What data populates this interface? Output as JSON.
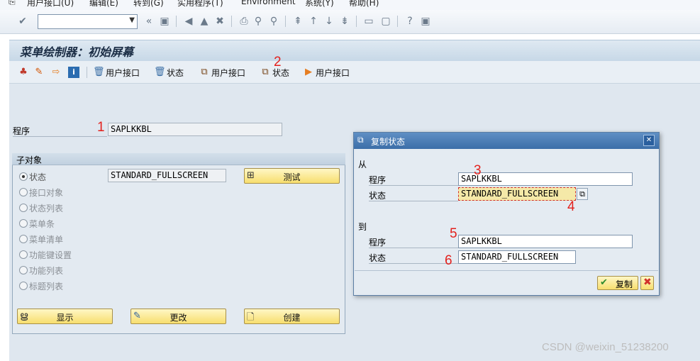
{
  "menu": {
    "items": [
      "用户接口(U)",
      "编辑(E)",
      "转到(G)",
      "实用程序(T)",
      "Environment",
      "系统(Y)",
      "帮助(H)"
    ]
  },
  "toolbar": {
    "command_value": "",
    "icons": [
      "enter-icon",
      "save-icon",
      "back-icon",
      "exit-icon",
      "cancel-icon",
      "print-icon",
      "find-icon",
      "find-next-icon",
      "first-page-icon",
      "prev-page-icon",
      "next-page-icon",
      "last-page-icon",
      "new-session-icon",
      "shortcut-icon",
      "help-icon",
      "layout-icon"
    ]
  },
  "page": {
    "title": "菜单绘制器：初始屏幕"
  },
  "app_toolbar": {
    "btn_user_interface_1": "用户接口",
    "btn_status_1": "状态",
    "btn_user_interface_2": "用户接口",
    "btn_status_2": "状态",
    "btn_user_interface_3": "用户接口"
  },
  "main": {
    "program_label": "程序",
    "program_value": "SAPLKKBL",
    "group_title": "子对象",
    "status_value": "STANDARD_FULLSCREEN",
    "radios": [
      "状态",
      "接口对象",
      "状态列表",
      "菜单条",
      "菜单清单",
      "功能键设置",
      "功能列表",
      "标题列表"
    ],
    "selected_radio": "状态",
    "test_button": "测试",
    "display_button": "显示",
    "change_button": "更改",
    "create_button": "创建"
  },
  "dialog": {
    "title": "复制状态",
    "from_label": "从",
    "from_program_label": "程序",
    "from_program_value": "SAPLKKBL",
    "from_status_label": "状态",
    "from_status_value": "STANDARD_FULLSCREEN",
    "to_label": "到",
    "to_program_label": "程序",
    "to_program_value": "SAPLKKBL",
    "to_status_label": "状态",
    "to_status_value": "STANDARD_FULLSCREEN",
    "copy_button": "复制"
  },
  "annotations": [
    "1",
    "2",
    "3",
    "4",
    "5",
    "6"
  ],
  "watermark": "CSDN @weixin_51238200",
  "colors": {
    "accent": "#3c6ea8",
    "button_yellow": "#f7de6e",
    "annotation_red": "#e3211d"
  }
}
